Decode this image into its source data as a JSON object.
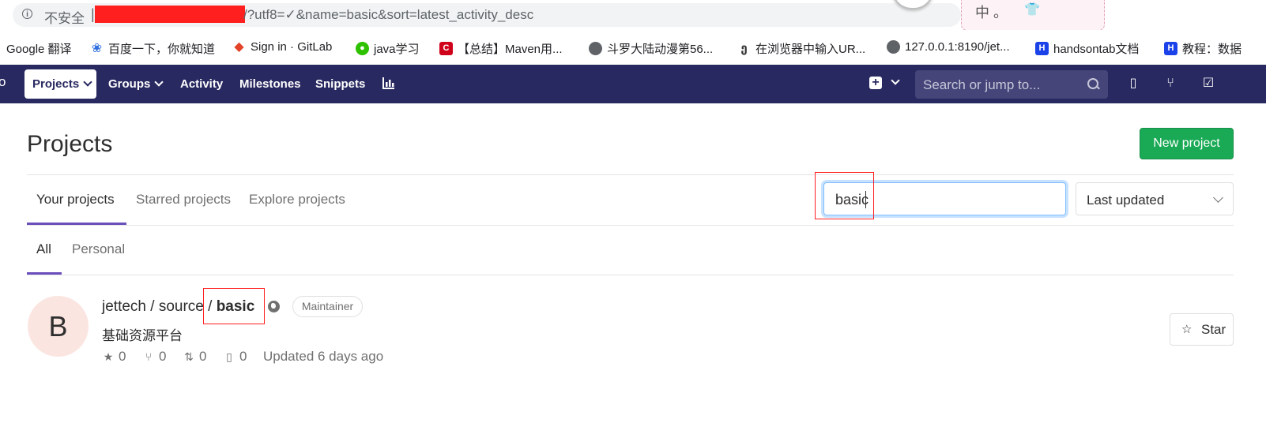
{
  "browser": {
    "insecure_label": "不安全",
    "url_separator": "|",
    "url_visible": "/?utf8=✓&name=basic&sort=latest_activity_desc",
    "sticker_char": "中 。",
    "bookmarks": [
      {
        "label": "Google 翻译",
        "icon": "google-translate-icon",
        "color": "#ffffff"
      },
      {
        "label": "百度一下，你就知道",
        "icon": "baidu-paw-icon",
        "color": "#2f6fde"
      },
      {
        "label": "Sign in · GitLab",
        "icon": "gitlab-fox-icon",
        "color": "#e24329"
      },
      {
        "label": "java学习",
        "icon": "wechat-icon",
        "color": "#2dc100"
      },
      {
        "label": "【总结】Maven用...",
        "icon": "csdn-icon",
        "color": "#d0021b"
      },
      {
        "label": "斗罗大陆动漫第56...",
        "icon": "globe-icon",
        "color": "#5f6368"
      },
      {
        "label": "在浏览器中输入UR...",
        "icon": "yuque-icon",
        "color": "#333333"
      },
      {
        "label": "127.0.0.1:8190/jet...",
        "icon": "globe-icon",
        "color": "#5f6368"
      },
      {
        "label": "handsontab文档",
        "icon": "handsontable-icon",
        "color": "#1a42e8"
      },
      {
        "label": "教程：数据",
        "icon": "handsontable-icon",
        "color": "#1a42e8"
      }
    ]
  },
  "navbar": {
    "edge_text": "o",
    "projects": "Projects",
    "groups": "Groups",
    "activity": "Activity",
    "milestones": "Milestones",
    "snippets": "Snippets",
    "search_placeholder": "Search or jump to...",
    "colors": {
      "background": "#292961",
      "search_bg": "#45457a"
    }
  },
  "page": {
    "title": "Projects",
    "new_project": "New project",
    "tabs": [
      "Your projects",
      "Starred projects",
      "Explore projects"
    ],
    "filter_value": "basic",
    "sort_label": "Last updated",
    "subtabs": [
      "All",
      "Personal"
    ]
  },
  "project": {
    "avatar_letter": "B",
    "namespace": "jettech / source / ",
    "name": "basic",
    "role": "Maintainer",
    "description": "基础资源平台",
    "stars": "0",
    "forks": "0",
    "merge_requests": "0",
    "issues": "0",
    "updated": "Updated 6 days ago",
    "star_button": "Star"
  },
  "colors": {
    "accent_green": "#1aaa55",
    "tab_underline": "#6b4fbb",
    "annotation_red": "#ff2020"
  }
}
